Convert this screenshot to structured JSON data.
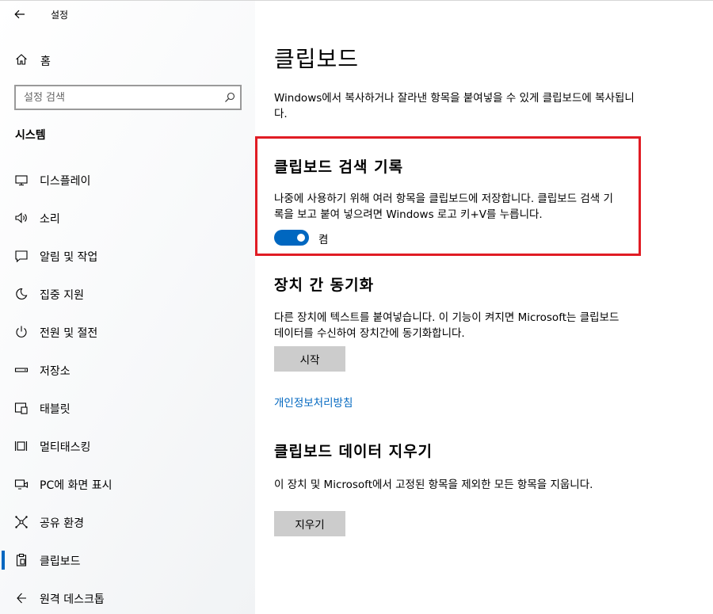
{
  "app": {
    "title": "설정"
  },
  "sidebar": {
    "home_label": "홈",
    "search_placeholder": "설정 검색",
    "section_heading": "시스템",
    "items": [
      {
        "label": "디스플레이",
        "icon": "monitor-icon"
      },
      {
        "label": "소리",
        "icon": "speaker-icon"
      },
      {
        "label": "알림 및 작업",
        "icon": "notification-icon"
      },
      {
        "label": "집중 지원",
        "icon": "moon-icon"
      },
      {
        "label": "전원 및 절전",
        "icon": "power-icon"
      },
      {
        "label": "저장소",
        "icon": "storage-icon"
      },
      {
        "label": "태블릿",
        "icon": "tablet-icon"
      },
      {
        "label": "멀티태스킹",
        "icon": "multitasking-icon"
      },
      {
        "label": "PC에 화면 표시",
        "icon": "project-icon"
      },
      {
        "label": "공유 환경",
        "icon": "share-icon"
      },
      {
        "label": "클립보드",
        "icon": "clipboard-icon",
        "selected": true
      },
      {
        "label": "원격 데스크톱",
        "icon": "remote-desktop-icon"
      }
    ]
  },
  "main": {
    "title": "클립보드",
    "intro": "Windows에서 복사하거나 잘라낸 항목을 붙여넣을 수 있게 클립보드에 복사됩니다.",
    "history": {
      "title": "클립보드 검색 기록",
      "description": "나중에 사용하기 위해 여러 항목을 클립보드에 저장합니다. 클립보드 검색 기록을 보고 붙여 넣으려면 Windows 로고 키+V를 누릅니다.",
      "toggle_state": "켬",
      "toggle_on": true
    },
    "sync": {
      "title": "장치 간 동기화",
      "description": "다른 장치에 텍스트를 붙여넣습니다. 이 기능이 켜지면 Microsoft는 클립보드 데이터를 수신하여 장치간에 동기화합니다.",
      "button": "시작"
    },
    "privacy_link": "개인정보처리방침",
    "clear": {
      "title": "클립보드 데이터 지우기",
      "description": "이 장치 및 Microsoft에서 고정된 항목을 제외한 모든 항목을 지웁니다.",
      "button": "지우기"
    }
  },
  "colors": {
    "accent": "#0067c0",
    "highlight_border": "#e01c24",
    "button_bg": "#cccccc"
  }
}
